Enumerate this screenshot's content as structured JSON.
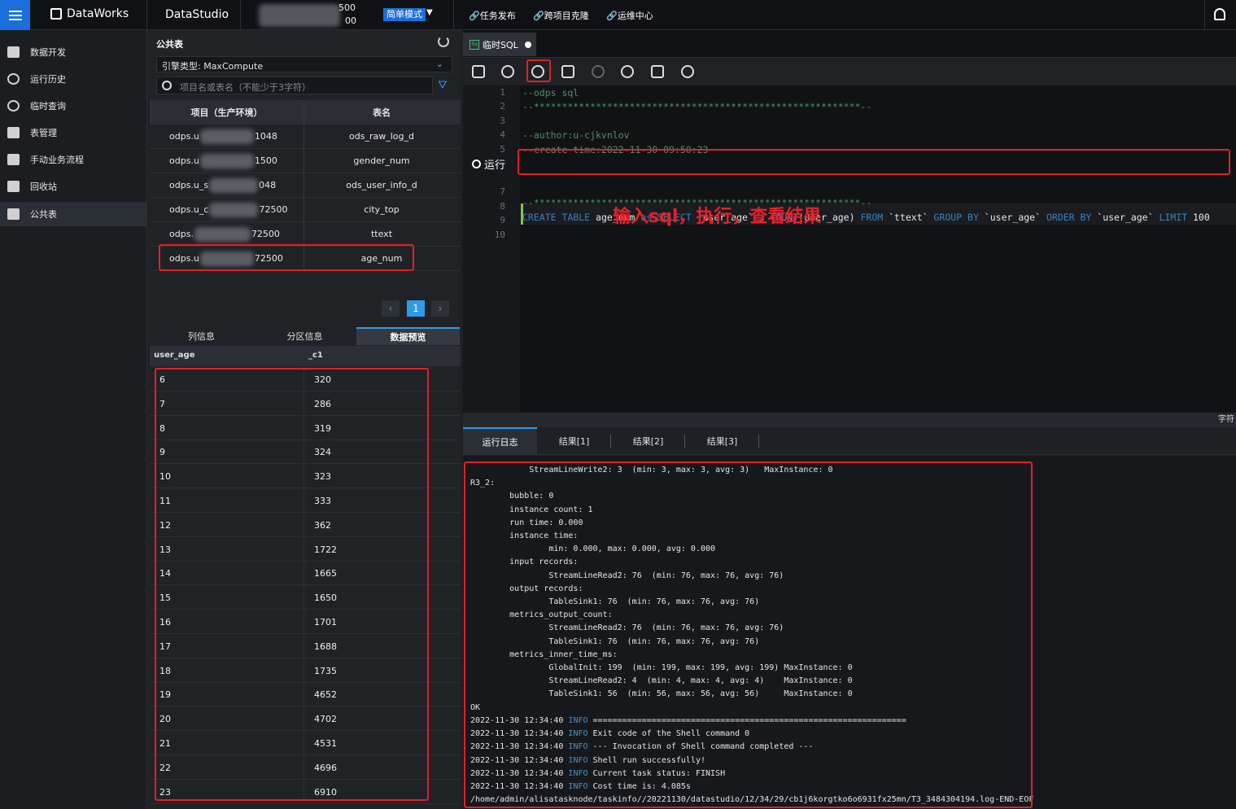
{
  "topbar": {
    "brand": "DataWorks",
    "studio": "DataStudio",
    "project_line1": "500",
    "project_line2": "00",
    "mode": "简单模式",
    "links": [
      "任务发布",
      "跨项目克隆",
      "运维中心"
    ]
  },
  "sidebar": {
    "items": [
      "数据开发",
      "运行历史",
      "临时查询",
      "表管理",
      "手动业务流程",
      "回收站",
      "公共表"
    ]
  },
  "public_table": {
    "title": "公共表",
    "engine": "引擎类型: MaxCompute",
    "search_placeholder": "项目名或表名（不能少于3字符）",
    "col_project": "项目（生产环境）",
    "col_table": "表名",
    "rows": [
      {
        "project": "odps.u",
        "suffix": "048",
        "table": "ods_raw_log_d",
        "mid": "1"
      },
      {
        "project": "odps.u",
        "suffix": "500",
        "table": "gender_num",
        "mid": "1"
      },
      {
        "project": "odps.u_s",
        "suffix": "048",
        "table": "ods_user_info_d",
        "mid": ""
      },
      {
        "project": "odps.u_c",
        "suffix": "72500",
        "table": "city_top",
        "mid": ""
      },
      {
        "project": "odps.",
        "suffix": "72500",
        "table": "ttext",
        "mid": ""
      },
      {
        "project": "odps.u",
        "suffix": "72500",
        "table": "age_num",
        "mid": ""
      }
    ],
    "page": "1",
    "tabs": [
      "列信息",
      "分区信息",
      "数据预览"
    ],
    "preview_cols": [
      "user_age",
      "_c1"
    ],
    "preview_rows": [
      [
        "6",
        "320"
      ],
      [
        "7",
        "286"
      ],
      [
        "8",
        "319"
      ],
      [
        "9",
        "324"
      ],
      [
        "10",
        "323"
      ],
      [
        "11",
        "333"
      ],
      [
        "12",
        "362"
      ],
      [
        "13",
        "1722"
      ],
      [
        "14",
        "1665"
      ],
      [
        "15",
        "1650"
      ],
      [
        "16",
        "1701"
      ],
      [
        "17",
        "1688"
      ],
      [
        "18",
        "1735"
      ],
      [
        "19",
        "4652"
      ],
      [
        "20",
        "4702"
      ],
      [
        "21",
        "4531"
      ],
      [
        "22",
        "4696"
      ],
      [
        "23",
        "6910"
      ]
    ]
  },
  "editor": {
    "tab": "临时SQL",
    "run_label": "运行",
    "annotation": "输入sql，执行，查看结果",
    "lines": [
      "--odps sql",
      "--**********************************************************--",
      "",
      "--author:u-cjkvnlov",
      "--create time:2022-11-30 09:50:23",
      "--**********************************************************--",
      "",
      "",
      "",
      ""
    ],
    "line_numbers": [
      "1",
      "2",
      "3",
      "4",
      "5",
      "6",
      "7",
      "8",
      "9",
      "10"
    ],
    "sql": {
      "p1": "CREATE TABLE ",
      "p2": "age_num ",
      "p3": "as SELECT ",
      "p4": "`user_age` , ",
      "p5": "COUNT",
      "p6": "(user_age) ",
      "p7": "FROM ",
      "p8": "`ttext` ",
      "p9": "GROUP BY ",
      "p10": "`user_age` ",
      "p11": "ORDER BY ",
      "p12": "`user_age` ",
      "p13": "LIMIT ",
      "p14": "100"
    }
  },
  "divider_label": "字符",
  "results": {
    "tabs": [
      "运行日志",
      "结果[1]",
      "结果[2]",
      "结果[3]"
    ],
    "log": [
      [
        "            StreamLineWrite2: 3  (min: 3, max: 3, avg: 3)   MaxInstance: 0",
        ""
      ],
      [
        "R3_2:",
        ""
      ],
      [
        "        bubble: 0",
        ""
      ],
      [
        "        instance count: 1",
        ""
      ],
      [
        "        run time: 0.000",
        ""
      ],
      [
        "        instance time:",
        ""
      ],
      [
        "                min: 0.000, max: 0.000, avg: 0.000",
        ""
      ],
      [
        "        input records:",
        ""
      ],
      [
        "                StreamLineRead2: 76  (min: 76, max: 76, avg: 76)",
        ""
      ],
      [
        "        output records:",
        ""
      ],
      [
        "                TableSink1: 76  (min: 76, max: 76, avg: 76)",
        ""
      ],
      [
        "        metrics_output_count:",
        ""
      ],
      [
        "                StreamLineRead2: 76  (min: 76, max: 76, avg: 76)",
        ""
      ],
      [
        "                TableSink1: 76  (min: 76, max: 76, avg: 76)",
        ""
      ],
      [
        "        metrics_inner_time_ms:",
        ""
      ],
      [
        "                GlobalInit: 199  (min: 199, max: 199, avg: 199) MaxInstance: 0",
        ""
      ],
      [
        "                StreamLineRead2: 4  (min: 4, max: 4, avg: 4)    MaxInstance: 0",
        ""
      ],
      [
        "                TableSink1: 56  (min: 56, max: 56, avg: 56)     MaxInstance: 0",
        ""
      ],
      [
        "OK",
        ""
      ]
    ],
    "info_lines": [
      {
        "ts": "2022-11-30 12:34:40 ",
        "lvl": "INFO",
        "msg": " ================================================================"
      },
      {
        "ts": "2022-11-30 12:34:40 ",
        "lvl": "INFO",
        "msg": " Exit code of the Shell command 0"
      },
      {
        "ts": "2022-11-30 12:34:40 ",
        "lvl": "INFO",
        "msg": " --- Invocation of Shell command completed ---"
      },
      {
        "ts": "2022-11-30 12:34:40 ",
        "lvl": "INFO",
        "msg": " Shell run successfully!"
      },
      {
        "ts": "2022-11-30 12:34:40 ",
        "lvl": "INFO",
        "msg": " Current task status: FINISH"
      },
      {
        "ts": "2022-11-30 12:34:40 ",
        "lvl": "INFO",
        "msg": " Cost time is: 4.085s"
      }
    ],
    "last_line": "/home/admin/alisatasknode/taskinfo//20221130/datastudio/12/34/29/cb1j6korgtko6o6931fx25mn/T3_3484304194.log-END-EOF"
  }
}
